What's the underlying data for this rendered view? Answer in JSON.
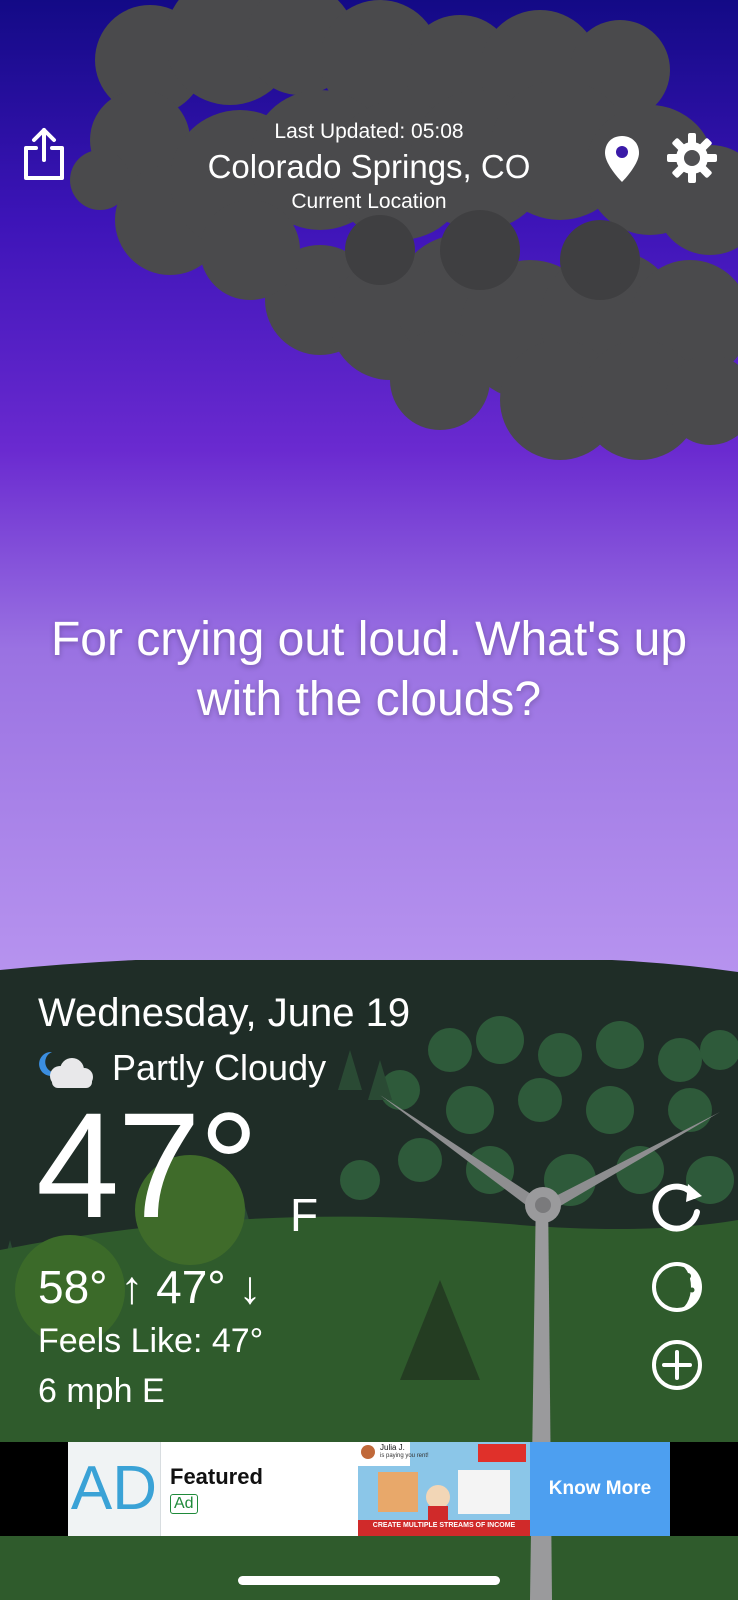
{
  "header": {
    "last_updated": "Last Updated: 05:08",
    "city": "Colorado Springs, CO",
    "location_label": "Current Location",
    "icons": {
      "share": "share-icon",
      "pin": "location-pin-icon",
      "settings": "gear-icon"
    }
  },
  "message": "For crying out loud. What's up with the clouds?",
  "weather": {
    "date": "Wednesday, June 19",
    "condition": "Partly Cloudy",
    "condition_icon": "partly-cloudy-night-icon",
    "temperature": "47°",
    "unit": "F",
    "hi_lo": "58° ↑ 47° ↓",
    "feels_like": "Feels Like: 47°",
    "wind": "6 mph E"
  },
  "side_actions": {
    "icons": [
      "refresh-icon",
      "moon-phase-icon",
      "add-icon"
    ]
  },
  "ad": {
    "logo_text": "AD",
    "title": "Featured",
    "tag": "Ad",
    "creative_name": "Julia J.",
    "creative_subtext": "is paying you rent!",
    "creative_caption": "CREATE MULTIPLE STREAMS OF INCOME",
    "cta": "Know More"
  },
  "colors": {
    "sky_top": "#130a86",
    "sky_bottom": "#b996f0",
    "ground_dark": "#1e2d24",
    "ad_cta": "#4d9ff0"
  }
}
